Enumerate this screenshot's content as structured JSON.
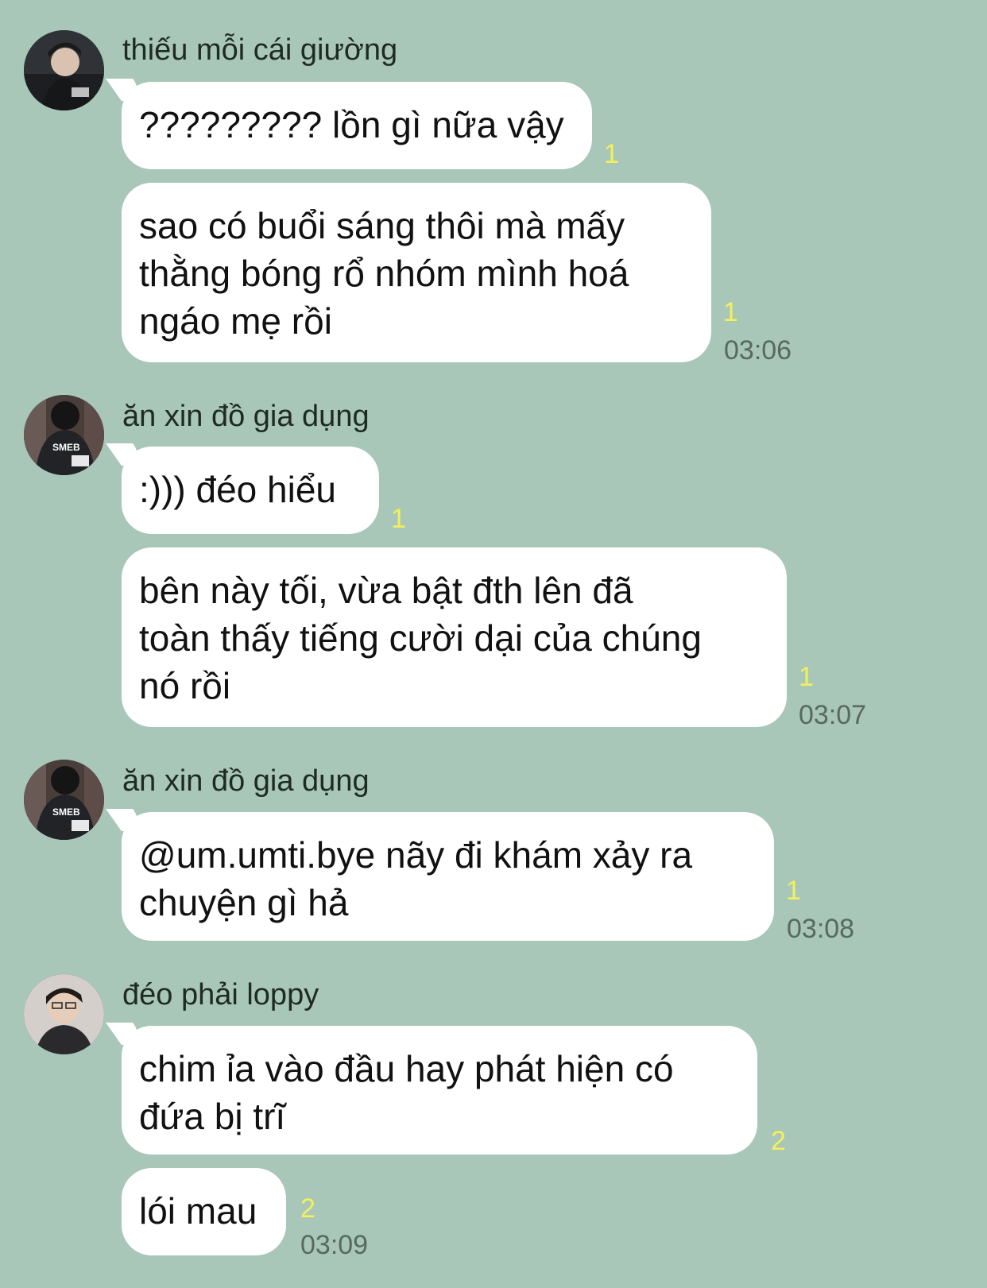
{
  "messages": [
    {
      "sender": "thiếu mỗi cái giường",
      "bubbles": [
        {
          "text": "????????? lồn gì nữa vậy",
          "read": "1",
          "time": ""
        },
        {
          "text": "sao có buổi sáng thôi mà mấy\nthằng bóng rổ nhóm mình hoá\nngáo mẹ rồi",
          "read": "1",
          "time": "03:06"
        }
      ]
    },
    {
      "sender": "ăn xin đồ gia dụng",
      "bubbles": [
        {
          "text": ":))) đéo hiểu",
          "read": "1",
          "time": ""
        },
        {
          "text": "bên này tối, vừa bật đth lên đã\ntoàn thấy tiếng cười dại của chúng\nnó rồi",
          "read": "1",
          "time": "03:07"
        }
      ]
    },
    {
      "sender": "ăn xin đồ gia dụng",
      "bubbles": [
        {
          "text": "@um.umti.bye nãy đi khám xảy ra\nchuyện gì hả",
          "read": "1",
          "time": "03:08"
        }
      ]
    },
    {
      "sender": "đéo phải loppy",
      "bubbles": [
        {
          "text": "chim ỉa vào đầu hay phát hiện có\nđứa bị trĩ",
          "read": "2",
          "time": ""
        },
        {
          "text": "lói mau",
          "read": "2",
          "time": "03:09"
        }
      ]
    }
  ],
  "avatars": {
    "jersey_text": "SMEB"
  },
  "colors": {
    "background": "#a8c7b8",
    "bubble": "#ffffff",
    "read_count": "#f6ef5c",
    "timestamp": "#58695f"
  }
}
